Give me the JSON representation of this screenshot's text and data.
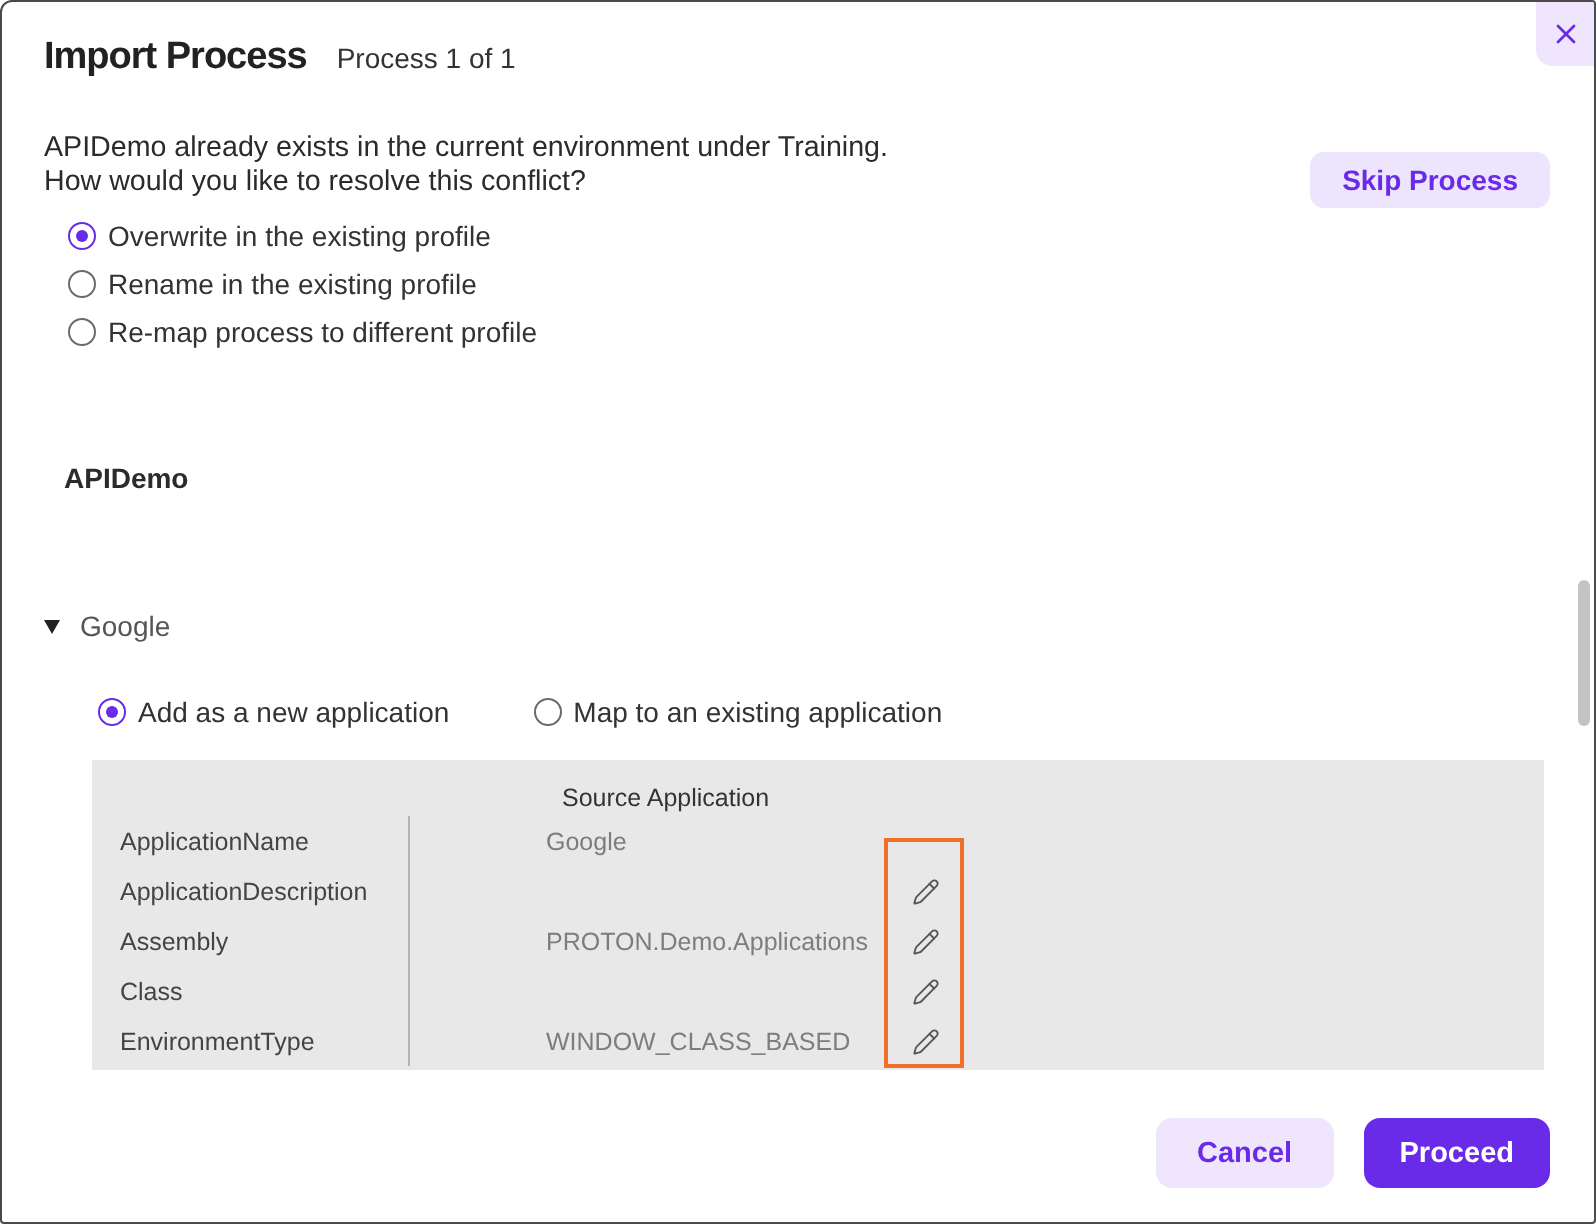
{
  "dialog": {
    "title": "Import Process",
    "subtitle": "Process 1 of 1"
  },
  "conflict": {
    "message": "APIDemo already exists in the current environment under Training.",
    "question": "How would you like to resolve this conflict?",
    "skip_button": "Skip Process"
  },
  "resolution_options": [
    {
      "label": "Overwrite in the existing profile",
      "selected": true
    },
    {
      "label": "Rename in the existing profile",
      "selected": false
    },
    {
      "label": "Re-map process to different profile",
      "selected": false
    }
  ],
  "process_name": "APIDemo",
  "applications": [
    {
      "name": "Google",
      "expanded": true,
      "mode_options": [
        {
          "label": "Add as a new application",
          "selected": true
        },
        {
          "label": "Map to an existing application",
          "selected": false
        }
      ],
      "table": {
        "heading": "Source Application",
        "rows": [
          {
            "field": "ApplicationName",
            "value": "Google",
            "editable": false
          },
          {
            "field": "ApplicationDescription",
            "editable": true
          },
          {
            "field": "Assembly",
            "value": "PROTON.Demo.Applications",
            "editable": true
          },
          {
            "field": "Class",
            "editable": true
          },
          {
            "field": "EnvironmentType",
            "value": "WINDOW_CLASS_BASED",
            "editable": true
          }
        ]
      }
    }
  ],
  "buttons": [
    {
      "label": "Cancel",
      "kind": "secondary"
    },
    {
      "label": "Proceed",
      "kind": "primary"
    }
  ]
}
